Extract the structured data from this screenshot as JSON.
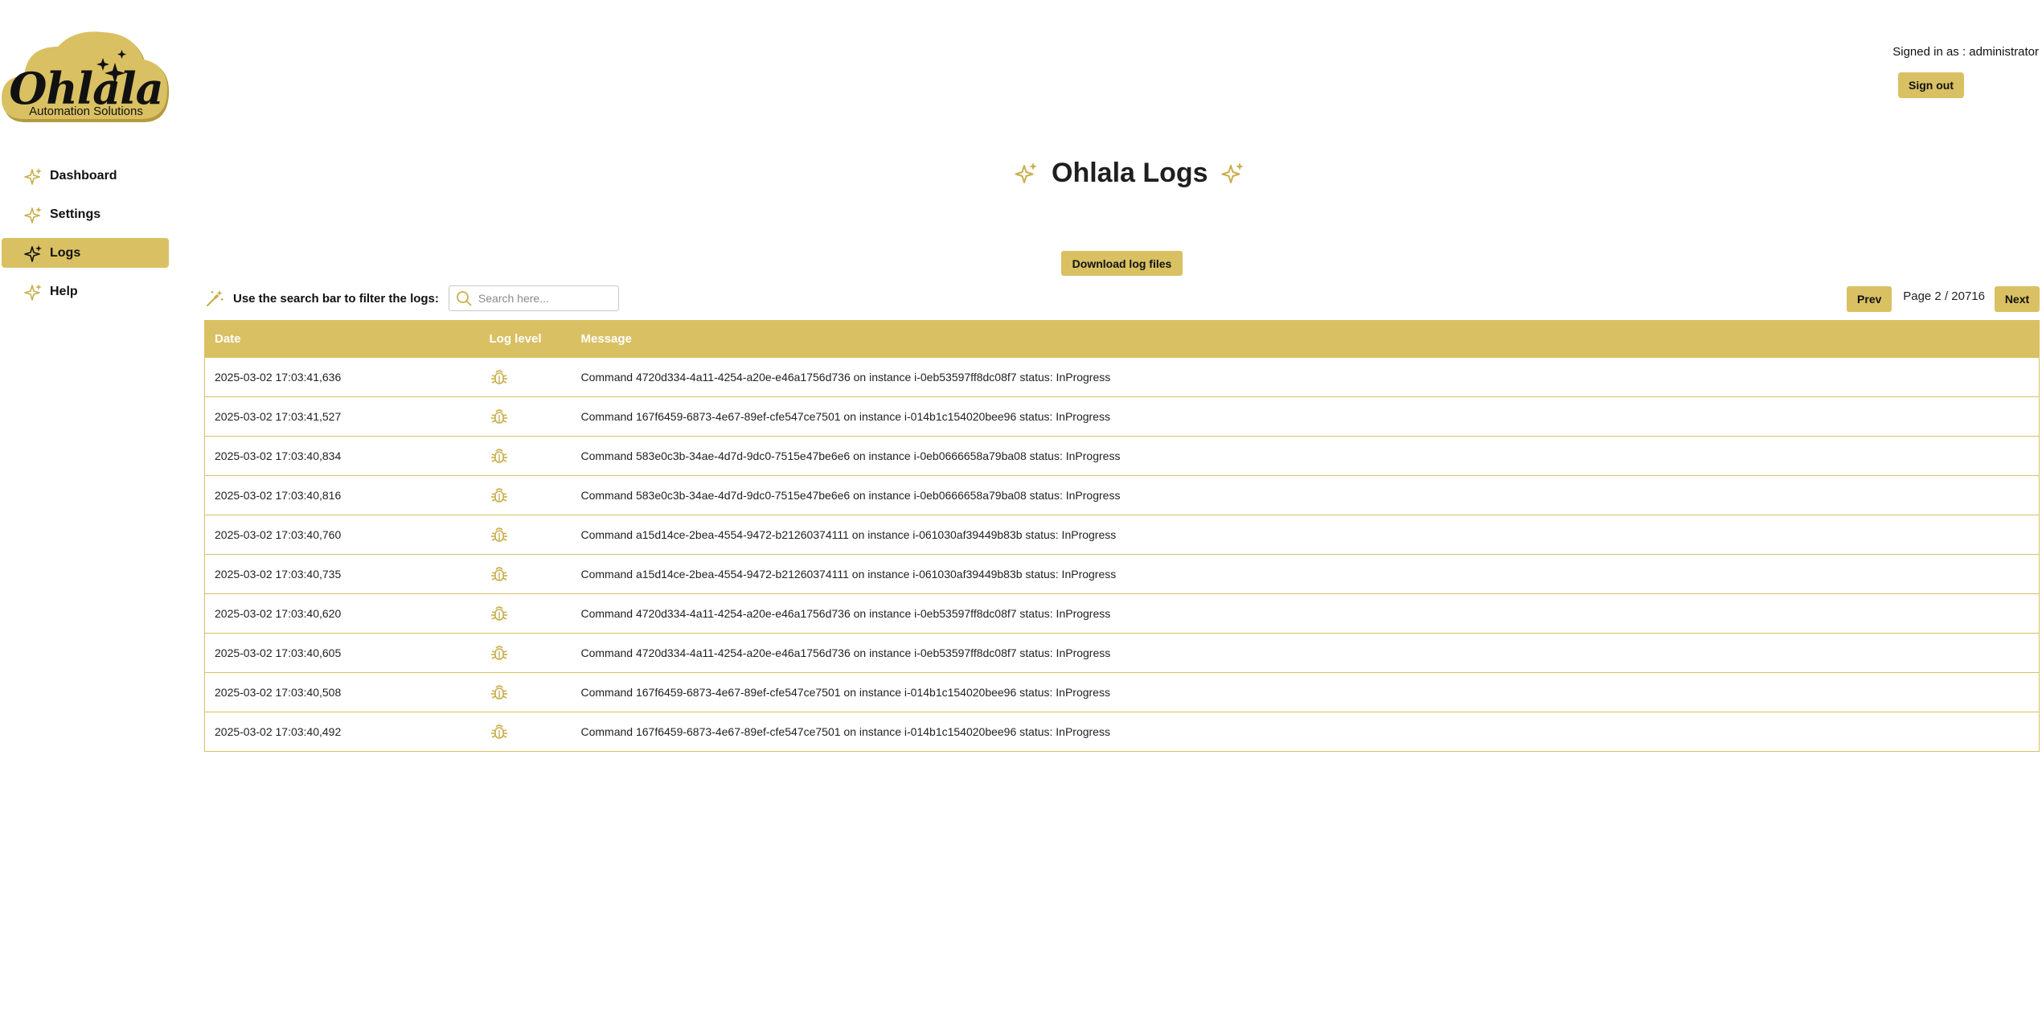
{
  "brand": {
    "name": "Ohlala",
    "tagline": "Automation Solutions",
    "accent_color": "#d9c063"
  },
  "sidebar": {
    "items": [
      {
        "label": "Dashboard",
        "icon": "sparkle-icon",
        "active": false
      },
      {
        "label": "Settings",
        "icon": "sparkle-icon",
        "active": false
      },
      {
        "label": "Logs",
        "icon": "sparkle-icon",
        "active": true
      },
      {
        "label": "Help",
        "icon": "sparkle-icon",
        "active": false
      }
    ]
  },
  "header": {
    "signed_in_text": "Signed in as : administrator",
    "sign_out_label": "Sign out"
  },
  "main": {
    "title": "Ohlala Logs",
    "download_label": "Download log files",
    "filter_label": "Use the search bar to filter the logs:",
    "search_placeholder": "Search here...",
    "search_value": "",
    "pager": {
      "prev_label": "Prev",
      "next_label": "Next",
      "page_text": "Page 2 / 20716"
    },
    "table": {
      "columns": [
        "Date",
        "Log level",
        "Message"
      ],
      "level_icon": "bug-icon",
      "rows": [
        {
          "date": "2025-03-02 17:03:41,636",
          "message": "Command 4720d334-4a11-4254-a20e-e46a1756d736 on instance i-0eb53597ff8dc08f7 status: InProgress"
        },
        {
          "date": "2025-03-02 17:03:41,527",
          "message": "Command 167f6459-6873-4e67-89ef-cfe547ce7501 on instance i-014b1c154020bee96 status: InProgress"
        },
        {
          "date": "2025-03-02 17:03:40,834",
          "message": "Command 583e0c3b-34ae-4d7d-9dc0-7515e47be6e6 on instance i-0eb0666658a79ba08 status: InProgress"
        },
        {
          "date": "2025-03-02 17:03:40,816",
          "message": "Command 583e0c3b-34ae-4d7d-9dc0-7515e47be6e6 on instance i-0eb0666658a79ba08 status: InProgress"
        },
        {
          "date": "2025-03-02 17:03:40,760",
          "message": "Command a15d14ce-2bea-4554-9472-b21260374111 on instance i-061030af39449b83b status: InProgress"
        },
        {
          "date": "2025-03-02 17:03:40,735",
          "message": "Command a15d14ce-2bea-4554-9472-b21260374111 on instance i-061030af39449b83b status: InProgress"
        },
        {
          "date": "2025-03-02 17:03:40,620",
          "message": "Command 4720d334-4a11-4254-a20e-e46a1756d736 on instance i-0eb53597ff8dc08f7 status: InProgress"
        },
        {
          "date": "2025-03-02 17:03:40,605",
          "message": "Command 4720d334-4a11-4254-a20e-e46a1756d736 on instance i-0eb53597ff8dc08f7 status: InProgress"
        },
        {
          "date": "2025-03-02 17:03:40,508",
          "message": "Command 167f6459-6873-4e67-89ef-cfe547ce7501 on instance i-014b1c154020bee96 status: InProgress"
        },
        {
          "date": "2025-03-02 17:03:40,492",
          "message": "Command 167f6459-6873-4e67-89ef-cfe547ce7501 on instance i-014b1c154020bee96 status: InProgress"
        }
      ]
    }
  }
}
